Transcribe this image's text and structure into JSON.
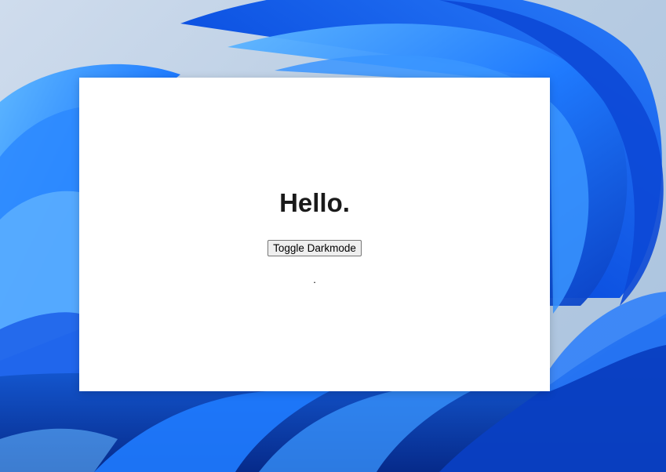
{
  "desktop": {
    "wallpaper": "windows-11-bloom",
    "accent_colors": [
      "#0a55e8",
      "#2b86ff",
      "#63b4ff",
      "#0b3ab5"
    ]
  },
  "window": {
    "background": "#ffffff",
    "heading": "Hello.",
    "toggle_button_label": "Toggle Darkmode",
    "status_text": "."
  }
}
